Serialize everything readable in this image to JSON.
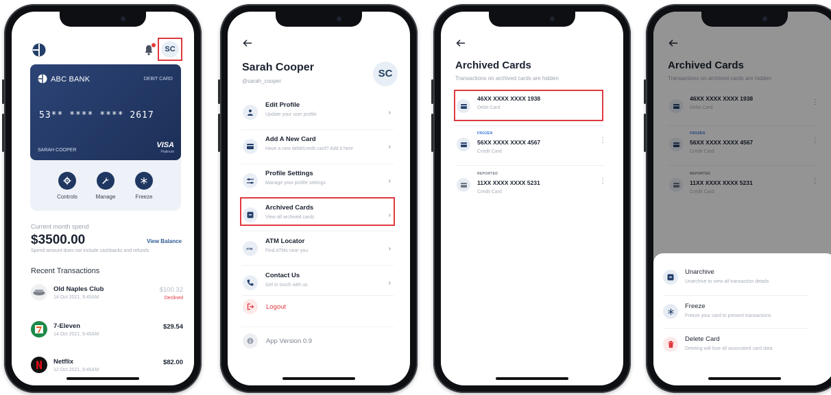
{
  "screen1": {
    "avatar_initials": "SC",
    "card": {
      "bank_name": "ABC BANK",
      "type_label": "DEBIT CARD",
      "number": "53** **** **** 2617",
      "holder": "SARAH COOPER",
      "network": "VISA",
      "tier": "Platinum"
    },
    "controls": [
      {
        "label": "Controls",
        "icon": "gear-icon"
      },
      {
        "label": "Manage",
        "icon": "wrench-icon"
      },
      {
        "label": "Freeze",
        "icon": "snowflake-icon"
      }
    ],
    "spend_label": "Current month spend",
    "spend_amount": "$3500.00",
    "view_balance": "View Balance",
    "spend_note": "Spend amount does not include cashbacks and refunds",
    "recent_title": "Recent Transactions",
    "transactions": [
      {
        "name": "Old Naples Club",
        "date": "14 Oct 2021, 9:45AM",
        "amount": "$100.32",
        "status": "Declined"
      },
      {
        "name": "7-Eleven",
        "date": "14 Oct 2021, 9:45AM",
        "amount": "$29.54",
        "status": ""
      },
      {
        "name": "Netflix",
        "date": "12 Oct 2021, 9:45AM",
        "amount": "$82.00",
        "status": ""
      }
    ]
  },
  "screen2": {
    "name": "Sarah Cooper",
    "handle": "@sarah_cooper",
    "avatar_initials": "SC",
    "menu": [
      {
        "title": "Edit Profile",
        "subtitle": "Update your user profile",
        "icon": "user-icon"
      },
      {
        "title": "Add A New Card",
        "subtitle": "Have a new debit/credit card? Add it here",
        "icon": "card-icon"
      },
      {
        "title": "Profile Settings",
        "subtitle": "Manage your profile settings",
        "icon": "sliders-icon"
      },
      {
        "title": "Archived Cards",
        "subtitle": "View all archived cards",
        "icon": "archive-icon"
      },
      {
        "title": "ATM Locator",
        "subtitle": "Find ATMs near you",
        "icon": "atm-icon"
      },
      {
        "title": "Contact Us",
        "subtitle": "Get in touch with us",
        "icon": "phone-icon"
      }
    ],
    "logout": "Logout",
    "version": "App Version 0.9"
  },
  "screen3": {
    "title": "Archived Cards",
    "subtitle": "Transactions on archived cards are hidden",
    "cards": [
      {
        "tag": "",
        "number": "46XX XXXX XXXX 1938",
        "kind": "Debit Card"
      },
      {
        "tag": "FROZEN",
        "number": "56XX XXXX XXXX 4567",
        "kind": "Credit Card"
      },
      {
        "tag": "REPORTED",
        "number": "11XX XXXX XXXX 5231",
        "kind": "Credit Card"
      }
    ]
  },
  "screen4": {
    "title": "Archived Cards",
    "subtitle": "Transactions on archived cards are hidden",
    "cards": [
      {
        "tag": "",
        "number": "46XX XXXX XXXX 1938",
        "kind": "Debit Card"
      },
      {
        "tag": "FROZEN",
        "number": "56XX XXXX XXXX 4567",
        "kind": "Credit Card"
      },
      {
        "tag": "REPORTED",
        "number": "11XX XXXX XXXX 5231",
        "kind": "Credit Card"
      }
    ],
    "sheet": [
      {
        "title": "Unarchive",
        "subtitle": "Unarchive to view all transaction details",
        "icon": "unarchive-icon"
      },
      {
        "title": "Freeze",
        "subtitle": "Freeze your card to prevent transactions",
        "icon": "snowflake-icon"
      },
      {
        "title": "Delete Card",
        "subtitle": "Deleting will lose all associated card data",
        "icon": "trash-icon"
      }
    ]
  },
  "colors": {
    "brand_navy": "#1f3761",
    "highlight_red": "#e0383e",
    "frozen_blue": "#2e6fd8",
    "reported_gray": "#6f7682"
  }
}
